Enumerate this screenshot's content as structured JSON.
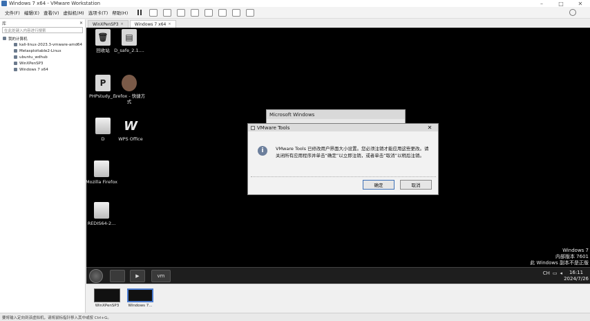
{
  "window": {
    "title": "Windows 7 x64 - VMware Workstation",
    "minimize": "–",
    "maximize": "□",
    "close": "✕"
  },
  "menu": [
    "文件(F)",
    "编辑(E)",
    "查看(V)",
    "虚拟机(M)",
    "选项卡(T)",
    "帮助(H)"
  ],
  "library": {
    "header": "库",
    "close": "✕",
    "search_placeholder": "在此处键入内容进行搜索",
    "root": "我的计算机",
    "vms": [
      "kali-linux-2023.3-vmware-amd64",
      "Metasploitable2-Linux",
      "ubuntu_wdhub",
      "WinXPenSP3",
      "Windows 7 x64"
    ]
  },
  "tabs": [
    {
      "label": "WinXPenSP3",
      "close": "×"
    },
    {
      "label": "Windows 7 x64",
      "close": "×"
    }
  ],
  "desktop_icons": [
    {
      "label": "回收站",
      "glyph": "🗑"
    },
    {
      "label": "D_safe_2.1....",
      "glyph": "▤"
    },
    {
      "label": "PHPstudy_...",
      "glyph": "P"
    },
    {
      "label": "firefox - 快捷方式",
      "glyph": ""
    },
    {
      "label": "D",
      "glyph": ""
    },
    {
      "label": "WPS Office",
      "glyph": "W"
    },
    {
      "label": "Mozilla Firefox",
      "glyph": ""
    },
    {
      "label": "REDIS64-2...",
      "glyph": ""
    }
  ],
  "dialog_back": {
    "title": "Microsoft Windows"
  },
  "dialog": {
    "title": "VMware Tools",
    "close": "✕",
    "icon": "i",
    "message": "VMware Tools 已修改用户界面大小设置。您必须注销才能应用这些更改。请关闭所有应用程序并单击“确定”以立即注销，或者单击“取消”以稍后注销。",
    "ok": "确定",
    "cancel": "取消"
  },
  "watermark": {
    "line1": "Windows 7",
    "line2": "内部版本 7601",
    "line3": "此 Windows 副本不是正版"
  },
  "taskbar": {
    "vm_label": "vm",
    "tray_lang": "CH",
    "time": "16:11",
    "date": "2024/7/26"
  },
  "thumbnails": [
    {
      "name": "WinXPenSP3"
    },
    {
      "name": "Windows 7..."
    }
  ],
  "status": "要将输入定向到该虚拟机，请将鼠标指针移入其中或按 Ctrl+G。"
}
